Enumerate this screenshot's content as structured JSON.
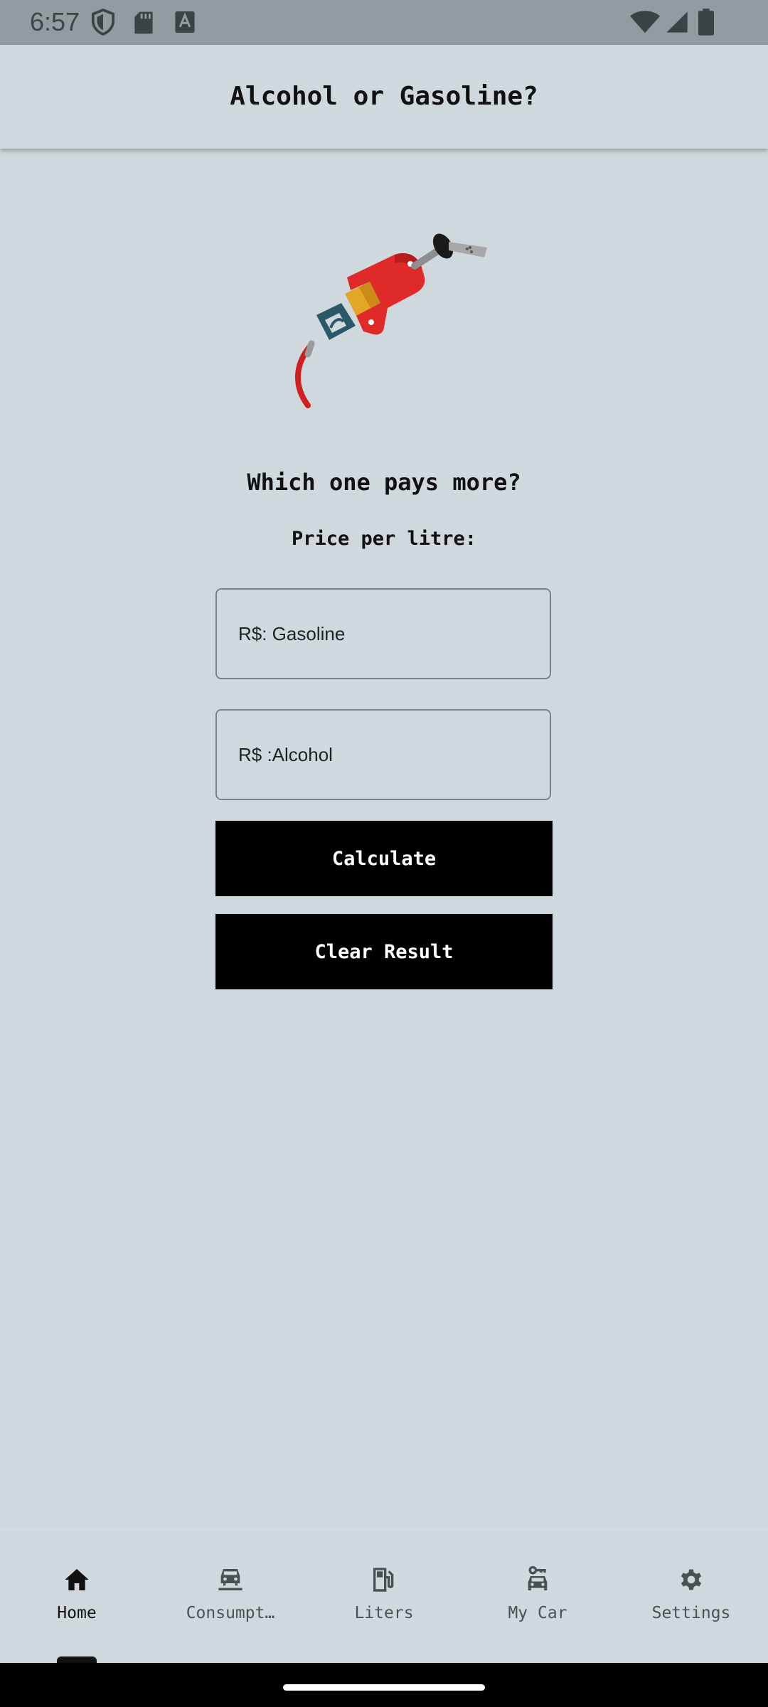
{
  "status_bar": {
    "time": "6:57",
    "left_icons": [
      "shield-icon",
      "sd-card-icon",
      "keyboard-a-icon"
    ],
    "right_icons": [
      "wifi-icon",
      "cell-signal-icon",
      "battery-icon"
    ]
  },
  "app_bar": {
    "title": "Alcohol or Gasoline?"
  },
  "hero": {
    "icon": "fuel-pump-nozzle-illustration",
    "colors": {
      "nozzle_body": "#e02a2a",
      "band": "#e3a626",
      "trigger": "#2a5866",
      "hose": "#d11f1f",
      "spout": "#8e8e8e"
    }
  },
  "main": {
    "heading": "Which one pays more?",
    "subheading": "Price per litre:",
    "gasoline_input": {
      "value": "",
      "placeholder": "R$: Gasoline"
    },
    "alcohol_input": {
      "value": "",
      "placeholder": "R$ :Alcohol"
    },
    "calculate_label": "Calculate",
    "clear_label": "Clear Result"
  },
  "bottom_nav": {
    "selected": "Home",
    "items": [
      {
        "label": "Home",
        "icon": "home-icon"
      },
      {
        "label": "Consumpt…",
        "icon": "car-on-lift-icon"
      },
      {
        "label": "Liters",
        "icon": "gas-station-icon"
      },
      {
        "label": "My Car",
        "icon": "car-key-icon"
      },
      {
        "label": "Settings",
        "icon": "gear-icon"
      }
    ]
  },
  "colors": {
    "background": "#cfd8dc",
    "status_bar": "#929ca0",
    "button": "#000000",
    "button_text": "#ffffff"
  }
}
